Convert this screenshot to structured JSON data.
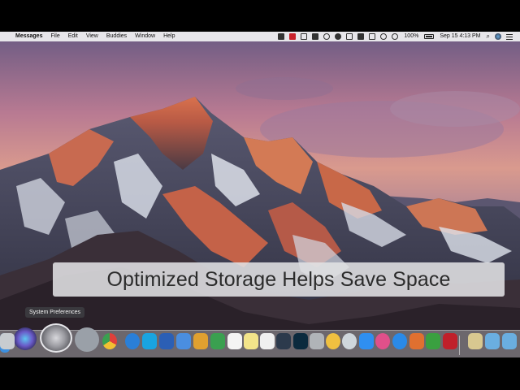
{
  "menubar": {
    "apple_icon": "apple-icon",
    "app_name": "Messages",
    "menus": [
      "File",
      "Edit",
      "View",
      "Buddies",
      "Window",
      "Help"
    ],
    "battery": "100%",
    "datetime": "Sep 15  4:13 PM"
  },
  "banner": {
    "text": "Optimized Storage Helps Save Space"
  },
  "tooltip": {
    "text": "System Preferences"
  },
  "dock": {
    "items": [
      {
        "name": "finder-icon",
        "color": "#3b8fe0"
      },
      {
        "name": "siri-icon",
        "color": "#3a3f8f"
      },
      {
        "name": "system-preferences-icon",
        "color": "#8e8e93"
      },
      {
        "name": "launchpad-icon",
        "color": "#9aa0a8"
      },
      {
        "name": "chrome-icon",
        "color": "#e0403a"
      },
      {
        "name": "safari-icon",
        "color": "#2a7fd8"
      },
      {
        "name": "skype-icon",
        "color": "#19a4e0"
      },
      {
        "name": "word-icon",
        "color": "#2b5fb5"
      },
      {
        "name": "app-icon-blue",
        "color": "#4a8ee0"
      },
      {
        "name": "app-icon-orange",
        "color": "#e0a030"
      },
      {
        "name": "app-icon-green",
        "color": "#3aa050"
      },
      {
        "name": "calendar-icon",
        "color": "#f4f4f4"
      },
      {
        "name": "notes-icon",
        "color": "#f3e48a"
      },
      {
        "name": "textedit-icon",
        "color": "#f0f0f0"
      },
      {
        "name": "lightroom-icon",
        "color": "#2c3a4c"
      },
      {
        "name": "photoshop-icon",
        "color": "#0b2a3e"
      },
      {
        "name": "app-icon-grey",
        "color": "#b0b4b8"
      },
      {
        "name": "photos-icon",
        "color": "#f0c040"
      },
      {
        "name": "network-icon",
        "color": "#cfd6dc"
      },
      {
        "name": "messages-icon",
        "color": "#2f8ff0"
      },
      {
        "name": "itunes-icon",
        "color": "#e0508a"
      },
      {
        "name": "app-store-icon",
        "color": "#2a8ae8"
      },
      {
        "name": "app-icon-multicolor",
        "color": "#e07030"
      },
      {
        "name": "camtasia-icon",
        "color": "#3aa040"
      },
      {
        "name": "photo-booth-icon",
        "color": "#c0202a"
      },
      {
        "name": "preview-icon",
        "color": "#d8c890"
      },
      {
        "name": "folder-icon",
        "color": "#6aaee0"
      },
      {
        "name": "downloads-folder-icon",
        "color": "#6aaee0"
      },
      {
        "name": "trash-icon",
        "color": "#c8ccd0"
      }
    ]
  }
}
